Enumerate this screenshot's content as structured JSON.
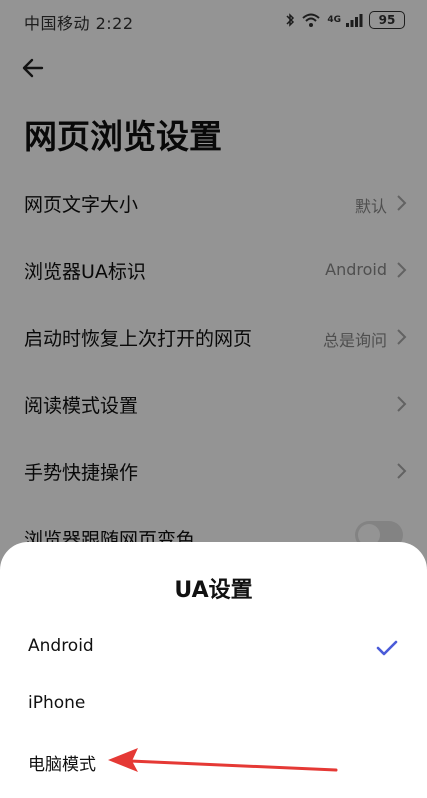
{
  "status_bar": {
    "carrier_time": "中国移动 2:22",
    "network": "4G",
    "battery": "95"
  },
  "page": {
    "title": "网页浏览设置"
  },
  "settings": [
    {
      "label": "网页文字大小",
      "value": "默认"
    },
    {
      "label": "浏览器UA标识",
      "value": "Android"
    },
    {
      "label": "启动时恢复上次打开的网页",
      "value": "总是询问"
    },
    {
      "label": "阅读模式设置",
      "value": ""
    },
    {
      "label": "手势快捷操作",
      "value": ""
    },
    {
      "label": "浏览器跟随网页变色",
      "toggle": false
    }
  ],
  "sheet": {
    "title": "UA设置",
    "options": [
      {
        "label": "Android",
        "selected": true
      },
      {
        "label": "iPhone",
        "selected": false
      },
      {
        "label": "电脑模式",
        "selected": false
      }
    ]
  },
  "colors": {
    "accent": "#4a5bd8",
    "annotation_arrow": "#e53935"
  }
}
